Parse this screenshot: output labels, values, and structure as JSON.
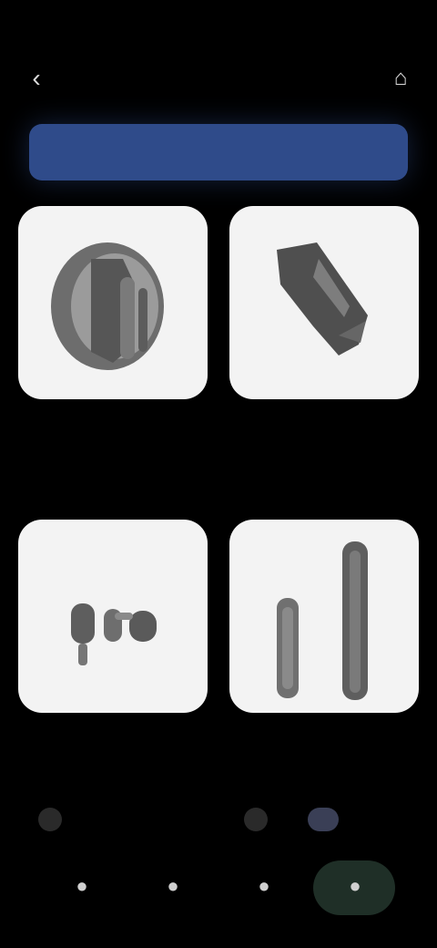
{
  "status_bar": {
    "time": "",
    "right": ""
  },
  "header": {
    "title": ""
  },
  "banner": {
    "text": ""
  },
  "products": [
    {
      "title": "",
      "price": "",
      "badge": ""
    },
    {
      "title": "",
      "price": "",
      "badge": ""
    },
    {
      "title": "",
      "price": "",
      "badge": ""
    },
    {
      "title": "",
      "price": "",
      "badge": ""
    }
  ],
  "footer_actions": {
    "left": "",
    "right": ""
  },
  "nav": {
    "items": [
      {
        "icon": "home-icon"
      },
      {
        "icon": "search-icon"
      },
      {
        "icon": "bag-icon"
      },
      {
        "icon": "profile-icon"
      }
    ]
  },
  "colors": {
    "background": "#000000",
    "banner": "#2f4b8a",
    "card": "#f3f3f3",
    "accent": "#7f9bd9",
    "nav_active": "#1f2f27"
  }
}
